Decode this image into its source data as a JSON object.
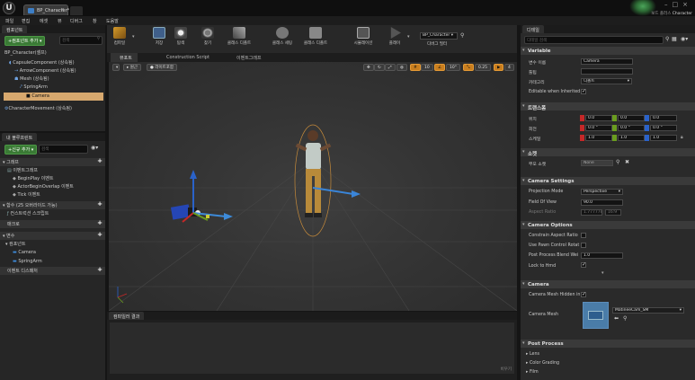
{
  "window": {
    "tab_label": "BP_Character*",
    "feedback_prefix": "보드 플러스",
    "feedback_name": "Character",
    "controls": "–□×"
  },
  "menu": [
    "파일",
    "편집",
    "에셋",
    "뷰",
    "디버그",
    "창",
    "도움말"
  ],
  "components_panel": {
    "title": "컴포넌트",
    "add_button": "+컴포넌트 추가 ▾",
    "search_placeholder": "검색",
    "root": "BP_Character(셀프)",
    "tree": [
      "CapsuleComponent (상속됨)",
      "ArrowComponent (상속됨)",
      "Mesh (상속됨)",
      "SpringArm",
      "Camera",
      "CharacterMovement (상속됨)"
    ]
  },
  "blueprint_panel": {
    "title": "내 블루프린트",
    "add_button": "+신규 추가 ▾",
    "search_placeholder": "검색",
    "rows": [
      "그래프",
      "이벤트그래프",
      "BeginPlay 이벤트",
      "ActorBeginOverlap 이벤트",
      "Tick 이벤트",
      "함수 (25 오버라이드 가능)",
      "컨스트럭션 스크립트",
      "매크로",
      "변수",
      "컴포넌트",
      "Camera",
      "SpringArm",
      "이벤트 디스패처"
    ]
  },
  "toolbar": {
    "buttons": [
      "컴파일",
      "저장",
      "탐색",
      "찾기",
      "클래스 디폴트",
      "클래스 세팅",
      "클래스 디폴트",
      "시뮬레이션",
      "플레이"
    ],
    "debug_filter_value": "BP_Character",
    "debug_filter_label": "디버그 필터"
  },
  "viewport_tabs": [
    "뷰포트",
    "Construction Script",
    "이벤트그래프"
  ],
  "viewport": {
    "perspective": "원근",
    "lighting": "라이트포함",
    "grid_snap": "10",
    "rot_snap": "10°",
    "scale_snap": "0.25",
    "camera_speed": "4"
  },
  "compiler": {
    "title": "컴파일러 결과",
    "clear": "비우기"
  },
  "details": {
    "title": "디테일",
    "search_placeholder": "디테일 검색",
    "sections": {
      "variable": "Variable",
      "transform": "트랜스폼",
      "sockets": "소켓",
      "camera_settings": "Camera Settings",
      "camera_options": "Camera Options",
      "camera": "Camera",
      "post_process": "Post Process"
    },
    "variable": {
      "name_label": "변수 이름",
      "name_value": "Camera",
      "tooltip_label": "툴팁",
      "category_label": "카테고리",
      "category_value": "디폴트",
      "editable_label": "Editable when Inherited"
    },
    "transform": {
      "location_label": "위치",
      "location": [
        "0.0",
        "0.0",
        "0.0"
      ],
      "rotation_label": "회전",
      "rotation": [
        "0.0 °",
        "0.0 °",
        "0.0 °"
      ],
      "scale_label": "스케일",
      "scale": [
        "1.0",
        "1.0",
        "1.0"
      ]
    },
    "sockets": {
      "parent_label": "부모 소켓",
      "parent_value": "None"
    },
    "camera_settings": {
      "projection_label": "Projection Mode",
      "projection_value": "Perspective",
      "fov_label": "Field Of View",
      "fov_value": "90.0",
      "aspect_label": "Aspect Ratio",
      "aspect_value": "1.777778",
      "aspect_value2": "16:9"
    },
    "camera_options": {
      "constrain_label": "Constrain Aspect Ratio",
      "pawn_label": "Use Pawn Control Rotat",
      "blend_label": "Post Process Blend Wei",
      "blend_value": "1.0",
      "lock_label": "Lock to Hmd"
    },
    "camera": {
      "hidden_label": "Camera Mesh Hidden in",
      "mesh_label": "Camera Mesh",
      "mesh_value": "MatineeCam_SM"
    },
    "post_process": [
      "Lens",
      "Color Grading",
      "Film"
    ]
  },
  "colors": {
    "accent_orange": "#d7a86e",
    "green_button": "#3a7a35",
    "axis_x": "#c62828",
    "axis_y": "#6a9c1f",
    "axis_z": "#2a62c9"
  }
}
